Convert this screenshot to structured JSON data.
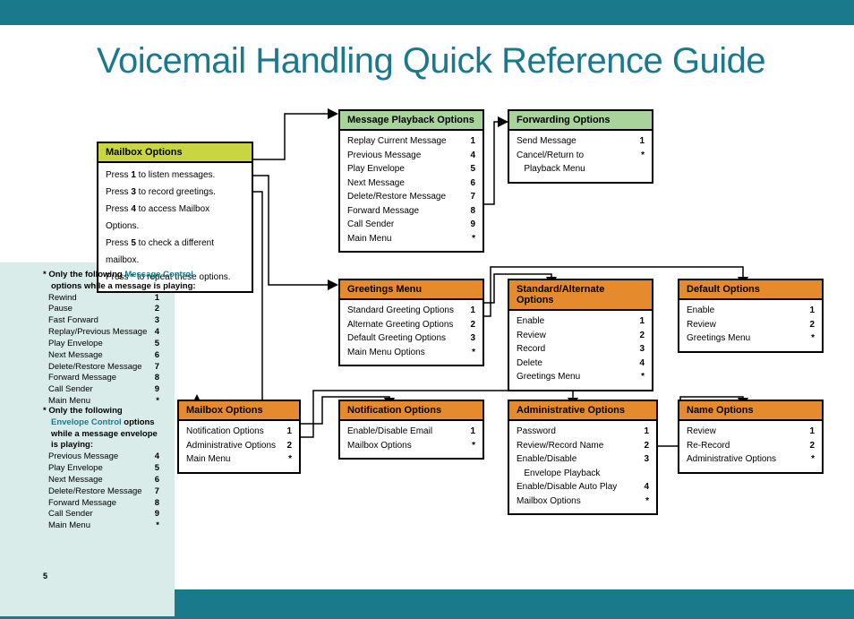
{
  "title": "Voicemail Handling Quick Reference Guide",
  "page_number": "5",
  "boxes": {
    "mailbox_instr": {
      "header": "Mailbox Options",
      "lines": [
        {
          "pre": "Press ",
          "key": "1",
          "post": " to listen messages."
        },
        {
          "pre": "Press ",
          "key": "3",
          "post": " to record greetings."
        },
        {
          "pre": "Press ",
          "key": "4",
          "post": " to access Mailbox Options."
        },
        {
          "pre": "Press ",
          "key": "5",
          "post": " to check a different mailbox."
        },
        {
          "pre": "Press ",
          "key": "*",
          "post": " to repeat these options."
        }
      ]
    },
    "playback": {
      "header": "Message Playback Options",
      "items": [
        {
          "label": "Replay Current Message",
          "key": "1"
        },
        {
          "label": "Previous Message",
          "key": "4"
        },
        {
          "label": "Play Envelope",
          "key": "5"
        },
        {
          "label": "Next Message",
          "key": "6"
        },
        {
          "label": "Delete/Restore Message",
          "key": "7"
        },
        {
          "label": "Forward Message",
          "key": "8"
        },
        {
          "label": "Call Sender",
          "key": "9"
        },
        {
          "label": "Main Menu",
          "key": "*"
        }
      ]
    },
    "forwarding": {
      "header": "Forwarding Options",
      "items": [
        {
          "label": "Send Message",
          "key": "1"
        },
        {
          "label": "Cancel/Return to\n   Playback Menu",
          "key": "*"
        }
      ]
    },
    "greetings": {
      "header": "Greetings Menu",
      "items": [
        {
          "label": "Standard Greeting Options",
          "key": "1"
        },
        {
          "label": "Alternate Greeting Options",
          "key": "2"
        },
        {
          "label": "Default Greeting Options",
          "key": "3"
        },
        {
          "label": "Main Menu Options",
          "key": "*"
        }
      ]
    },
    "std_alt": {
      "header": "Standard/Alternate Options",
      "items": [
        {
          "label": "Enable",
          "key": "1"
        },
        {
          "label": "Review",
          "key": "2"
        },
        {
          "label": "Record",
          "key": "3"
        },
        {
          "label": "Delete",
          "key": "4"
        },
        {
          "label": "Greetings Menu",
          "key": "*"
        }
      ]
    },
    "default_opts": {
      "header": "Default Options",
      "items": [
        {
          "label": "Enable",
          "key": "1"
        },
        {
          "label": "Review",
          "key": "2"
        },
        {
          "label": "Greetings Menu",
          "key": "*"
        }
      ]
    },
    "mailbox2": {
      "header": "Mailbox Options",
      "items": [
        {
          "label": "Notification Options",
          "key": "1"
        },
        {
          "label": "Administrative Options",
          "key": "2"
        },
        {
          "label": "Main Menu",
          "key": "*"
        }
      ]
    },
    "notification": {
      "header": "Notification Options",
      "items": [
        {
          "label": "Enable/Disable Email",
          "key": "1"
        },
        {
          "label": "Mailbox Options",
          "key": "*"
        }
      ]
    },
    "admin": {
      "header": "Administrative Options",
      "items": [
        {
          "label": "Password",
          "key": "1"
        },
        {
          "label": "Review/Record Name",
          "key": "2"
        },
        {
          "label": "Enable/Disable\n   Envelope Playback",
          "key": "3"
        },
        {
          "label": "Enable/Disable Auto Play",
          "key": "4"
        },
        {
          "label": "Mailbox Options",
          "key": "*"
        }
      ]
    },
    "name_opts": {
      "header": "Name Options",
      "items": [
        {
          "label": "Review",
          "key": "1"
        },
        {
          "label": "Re-Record",
          "key": "2"
        },
        {
          "label": "Administrative Options",
          "key": "*"
        }
      ]
    }
  },
  "sidebar": {
    "msg_control": {
      "lead_star": "*",
      "lead_a": "Only the following ",
      "lead_accent": "Message Control",
      "lead_b": "options while a message is playing:",
      "items": [
        {
          "label": "Rewind",
          "key": "1"
        },
        {
          "label": "Pause",
          "key": "2"
        },
        {
          "label": "Fast  Forward",
          "key": "3"
        },
        {
          "label": "Replay/Previous Message",
          "key": "4"
        },
        {
          "label": "Play Envelope",
          "key": "5"
        },
        {
          "label": "Next Message",
          "key": "6"
        },
        {
          "label": "Delete/Restore Message",
          "key": "7"
        },
        {
          "label": "Forward Message",
          "key": "8"
        },
        {
          "label": "Call Sender",
          "key": "9"
        },
        {
          "label": "Main Menu",
          "key": "*"
        }
      ]
    },
    "env_control": {
      "lead_star": "*",
      "lead_a": "Only the following",
      "lead_accent": "Envelope Control",
      "lead_b": " options",
      "lead_c": "while a message envelope",
      "lead_d": "is playing:",
      "items": [
        {
          "label": "Previous Message",
          "key": "4"
        },
        {
          "label": "Play Envelope",
          "key": "5"
        },
        {
          "label": "Next Message",
          "key": "6"
        },
        {
          "label": "Delete/Restore Message",
          "key": "7"
        },
        {
          "label": "Forward Message",
          "key": "8"
        },
        {
          "label": "Call Sender",
          "key": "9"
        },
        {
          "label": "Main Menu",
          "key": "*"
        }
      ]
    }
  }
}
